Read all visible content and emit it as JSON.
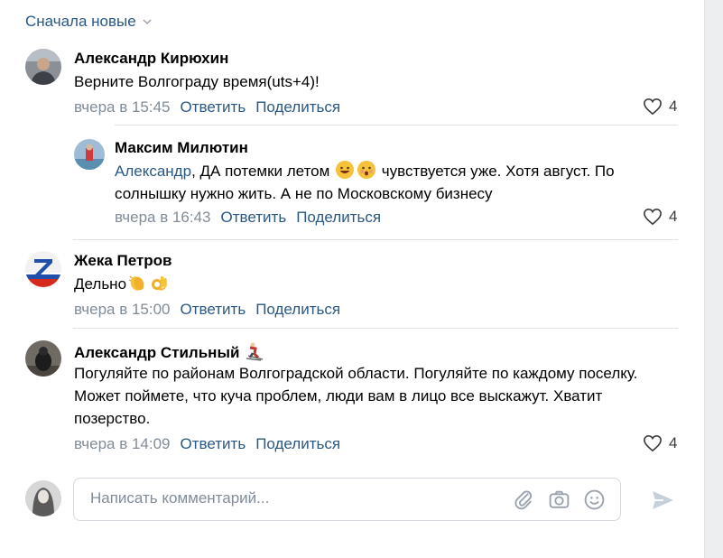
{
  "sort": {
    "label": "Сначала новые"
  },
  "comments": [
    {
      "author": "Александр Кирюхин",
      "text": "Верните Волгограду время(uts+4)!",
      "date": "вчера в 15:45",
      "reply": "Ответить",
      "share": "Поделиться",
      "likes": "4"
    },
    {
      "author": "Максим Милютин",
      "mention": "Александр",
      "text_part1": ", ДА потемки летом",
      "text_part2": " чувствуется уже. Хотя август. По солнышку нужно жить. А не по Московскому бизнесу",
      "date": "вчера в 16:43",
      "reply": "Ответить",
      "share": "Поделиться",
      "likes": "4"
    },
    {
      "author": "Жека Петров",
      "text": "Дельно",
      "date": "вчера в 15:00",
      "reply": "Ответить",
      "share": "Поделиться"
    },
    {
      "author": "Александр Стильный",
      "text": "Погуляйте по районам Волгоградской области. Погуляйте по каждому поселку. Может поймете, что куча проблем, люди вам в лицо все выскажут. Хватит позерство.",
      "date": "вчера в 14:09",
      "reply": "Ответить",
      "share": "Поделиться",
      "likes": "4"
    }
  ],
  "composer": {
    "placeholder": "Написать комментарий..."
  },
  "colors": {
    "link": "#2a5885",
    "muted": "#818c99",
    "separator": "#dce1e6"
  }
}
